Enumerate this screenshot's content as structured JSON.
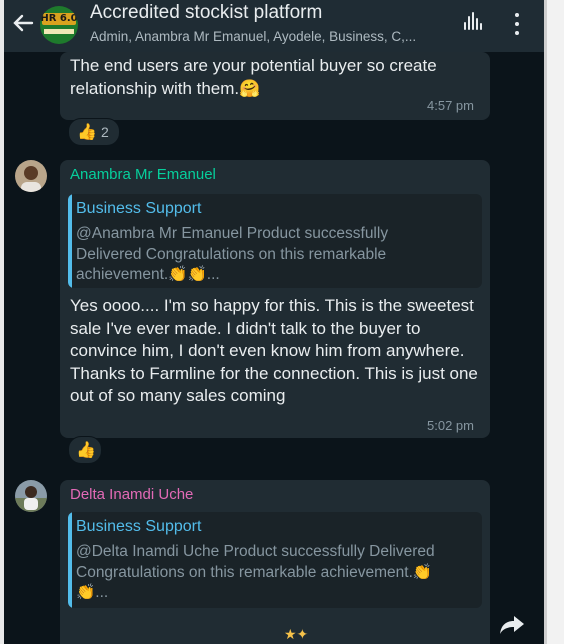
{
  "header": {
    "back_icon": "arrow-left",
    "group_logo_text": "HR 6.0",
    "title": "Accredited stockist platform",
    "subtitle": "Admin, Anambra Mr Emanuel, Ayodele, Business, C,...",
    "voice_icon": "voice-waveform",
    "menu_icon": "more-vertical"
  },
  "messages": [
    {
      "text": "The end users are your potential buyer so create relationship with them.",
      "emoji": "🤗",
      "time": "4:57 pm",
      "reaction": {
        "emoji": "👍",
        "count": "2"
      }
    },
    {
      "sender": "Anambra Mr Emanuel",
      "sender_color": "#06cf9c",
      "quote": {
        "author": "Business Support",
        "text": "@Anambra Mr Emanuel  Product successfully Delivered  Congratulations on this remarkable achievement.👏👏..."
      },
      "text": "Yes oooo.... I'm so happy for this. This is the sweetest sale I've ever made. I didn't talk to the buyer to convince him, I don't even know him from anywhere. Thanks to Farmline for the connection. This is just one out of so many sales coming",
      "time": "5:02 pm",
      "reaction": {
        "emoji": "👍"
      }
    },
    {
      "sender": "Delta Inamdi Uche",
      "sender_color": "#e26ab6",
      "quote": {
        "author": "Business Support",
        "text": "@Delta Inamdi Uche Product successfully Delivered  Congratulations on this remarkable achievement.👏👏..."
      }
    }
  ],
  "colors": {
    "header_bg": "#1f2c34",
    "chat_bg": "#0b141a",
    "bubble_bg": "#202c33",
    "quote_accent": "#53bdeb"
  },
  "icons": {
    "forward": "share-arrow-icon"
  }
}
